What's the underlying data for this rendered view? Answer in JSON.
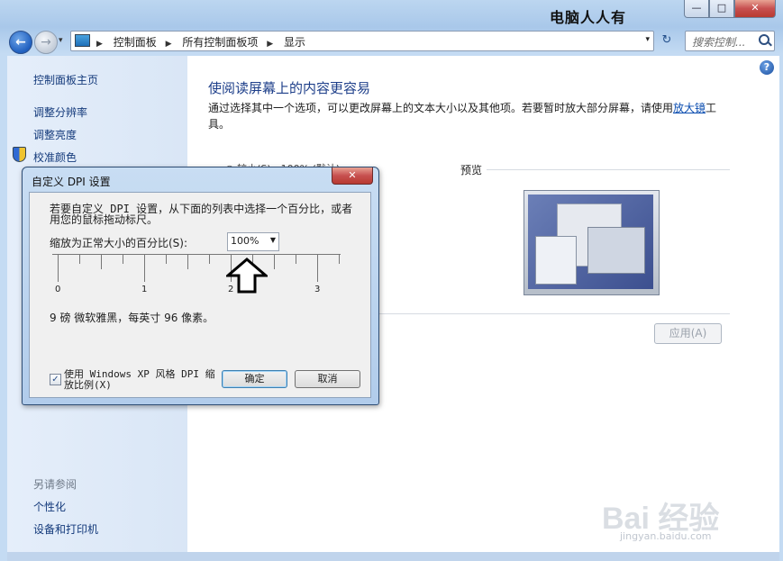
{
  "window": {
    "title_text": "电脑人人有",
    "minimize": "—",
    "maximize": "□",
    "close": "✕"
  },
  "nav": {
    "back_glyph": "←",
    "forward_glyph": "→",
    "dropdown_glyph": "▾",
    "breadcrumbs": [
      "控制面板",
      "所有控制面板项",
      "显示"
    ],
    "separator_glyph": "▶",
    "address_dropdown_glyph": "▾",
    "refresh_glyph": "↻",
    "search_placeholder": "搜索控制..."
  },
  "sidebar": {
    "home": "控制面板主页",
    "items": [
      "调整分辨率",
      "调整亮度",
      "校准颜色"
    ],
    "see_also_heading": "另请参阅",
    "see_also": [
      "个性化",
      "设备和打印机"
    ]
  },
  "main": {
    "help_glyph": "?",
    "title": "使阅读屏幕上的内容更容易",
    "desc_before": "通过选择其中一个选项，可以更改屏幕上的文本大小以及其他项。若要暂时放大部分屏幕，请使用",
    "desc_link": "放大镜",
    "desc_after": "工具。",
    "peek_text": "◉ 较小(S) - 100% (默认)",
    "preview_label": "预览",
    "apply_button": "应用(A)"
  },
  "dialog": {
    "title": "自定义 DPI 设置",
    "close_glyph": "✕",
    "instruction": "若要自定义 DPI 设置，从下面的列表中选择一个百分比，或者用您的鼠标拖动标尺。",
    "scale_label": "缩放为正常大小的百分比(S):",
    "scale_value": "100%",
    "scale_arrow": "▼",
    "ruler_numbers": [
      "0",
      "1",
      "2",
      "3"
    ],
    "font_info": "9 磅 微软雅黑，每英寸 96 像素。",
    "xp_checkbox_checked": true,
    "xp_check_glyph": "✓",
    "xp_label": "使用 Windows XP 风格 DPI 缩放比例(X)",
    "ok_button": "确定",
    "cancel_button": "取消"
  },
  "watermark": {
    "main": "Bai 经验",
    "sub": "jingyan.baidu.com"
  }
}
